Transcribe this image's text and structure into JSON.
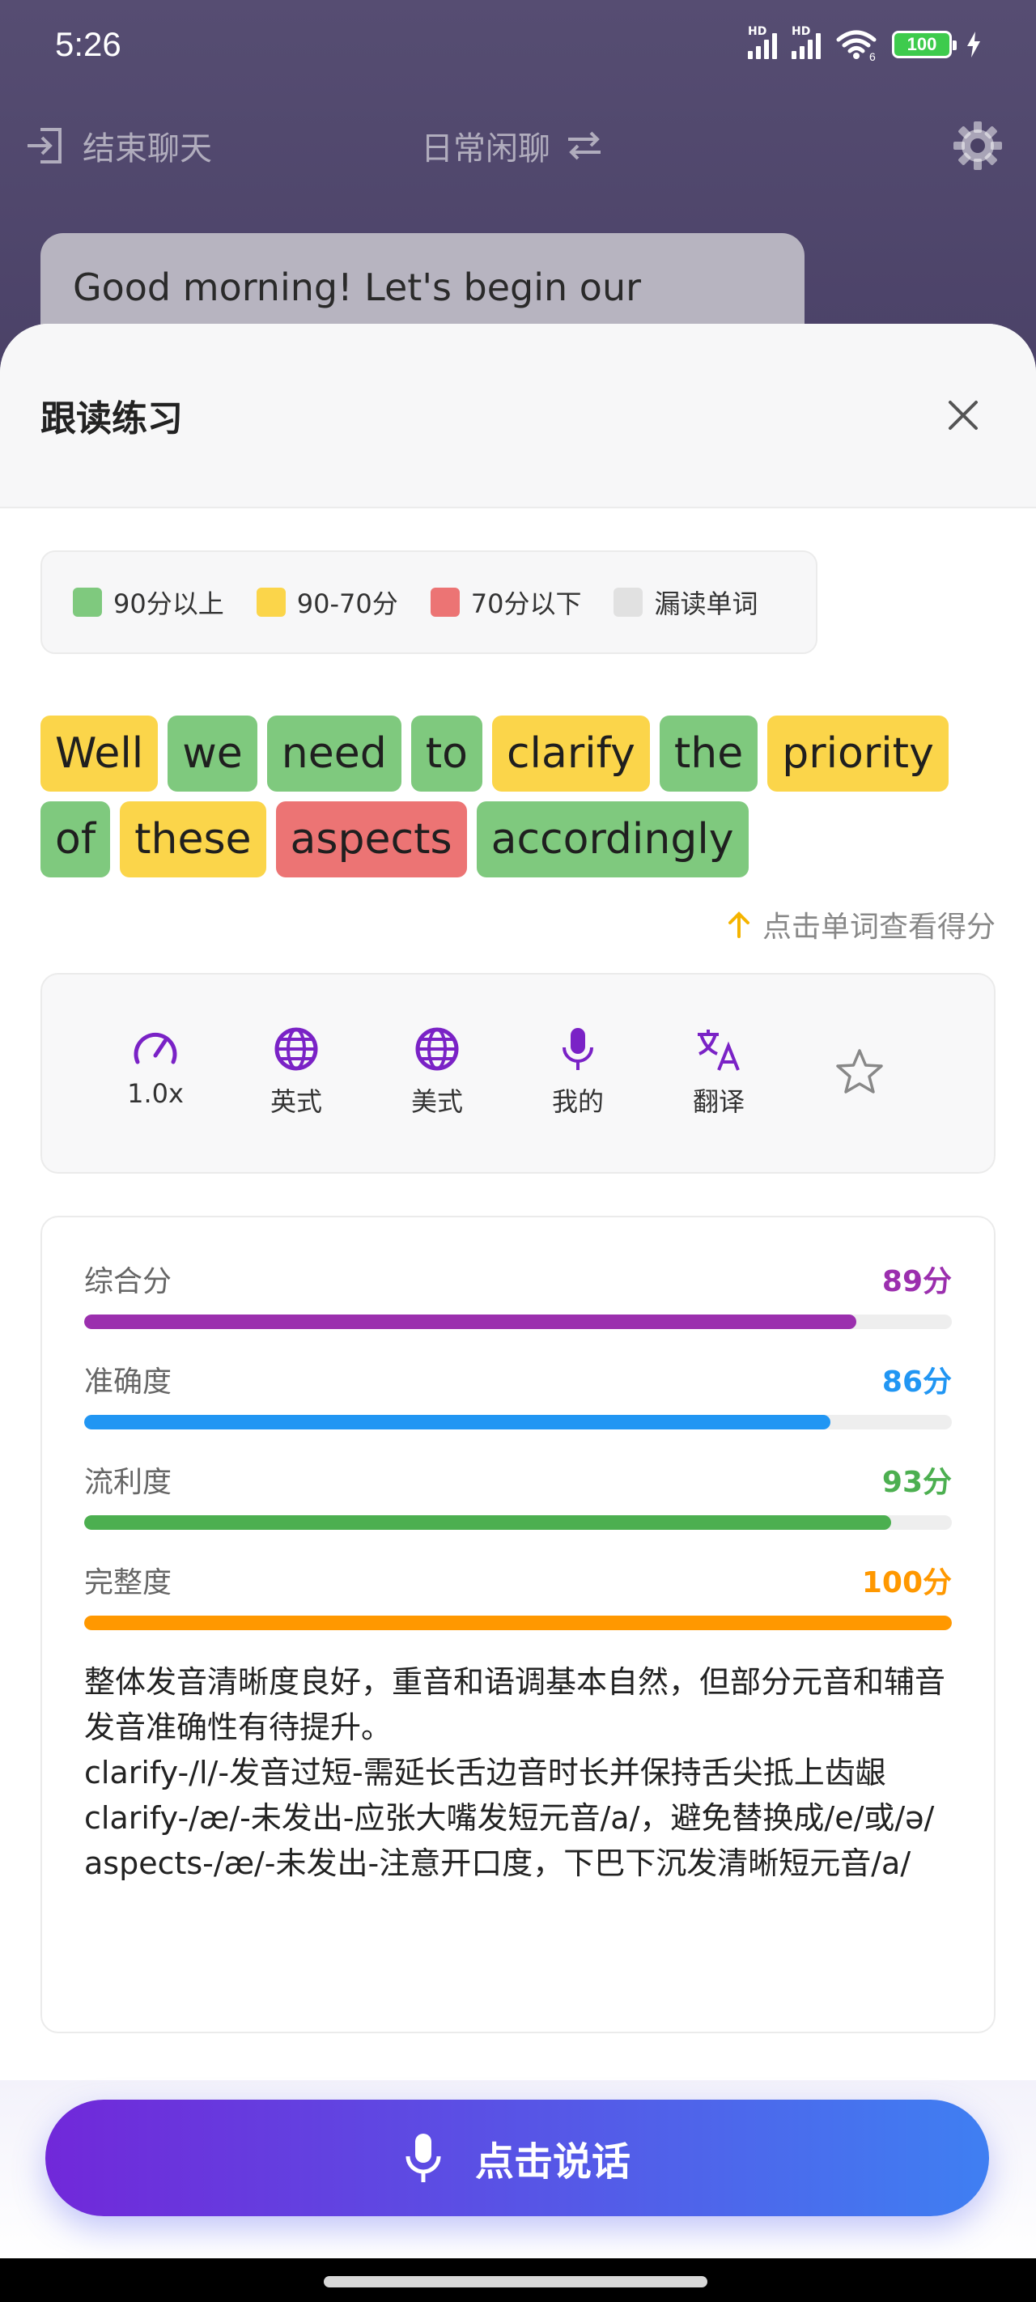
{
  "status_bar": {
    "time": "5:26",
    "network_1": "HD",
    "network_2": "HD",
    "wifi_label": "6",
    "battery": "100"
  },
  "topbar": {
    "end_chat_label": "结束聊天",
    "mode_label": "日常闲聊"
  },
  "chat": {
    "bubble_text": "Good morning! Let's begin our"
  },
  "sheet": {
    "title": "跟读练习"
  },
  "legend": [
    {
      "label": "90分以上",
      "color": "#7fc97e"
    },
    {
      "label": "90-70分",
      "color": "#fbd54a"
    },
    {
      "label": "70分以下",
      "color": "#ec7474"
    },
    {
      "label": "漏读单词",
      "color": "#e1e1e1"
    }
  ],
  "words": [
    {
      "text": "Well",
      "level": "yellow"
    },
    {
      "text": "we",
      "level": "green"
    },
    {
      "text": "need",
      "level": "green"
    },
    {
      "text": "to",
      "level": "green"
    },
    {
      "text": "clarify",
      "level": "yellow"
    },
    {
      "text": "the",
      "level": "green"
    },
    {
      "text": "priority",
      "level": "yellow"
    },
    {
      "text": "of",
      "level": "green"
    },
    {
      "text": "these",
      "level": "yellow"
    },
    {
      "text": "aspects",
      "level": "red"
    },
    {
      "text": "accordingly",
      "level": "green"
    }
  ],
  "hint": "点击单词查看得分",
  "tools": {
    "speed": "1.0x",
    "uk": "英式",
    "us": "美式",
    "mine": "我的",
    "translate": "翻译"
  },
  "scores": [
    {
      "name": "综合分",
      "value": "89分",
      "percent": 89,
      "color": "#9b2fae"
    },
    {
      "name": "准确度",
      "value": "86分",
      "percent": 86,
      "color": "#2196f3"
    },
    {
      "name": "流利度",
      "value": "93分",
      "percent": 93,
      "color": "#4caf50"
    },
    {
      "name": "完整度",
      "value": "100分",
      "percent": 100,
      "color": "#ff9800"
    }
  ],
  "feedback": [
    "整体发音清晰度良好，重音和语调基本自然，但部分元音和辅音发音准确性有待提升。",
    "clarify-/l/-发音过短-需延长舌边音时长并保持舌尖抵上齿龈",
    "clarify-/æ/-未发出-应张大嘴发短元音/a/，避免替换成/e/或/ə/",
    "aspects-/æ/-未发出-注意开口度，下巴下沉发清晰短元音/a/"
  ],
  "speak_button": "点击说话"
}
